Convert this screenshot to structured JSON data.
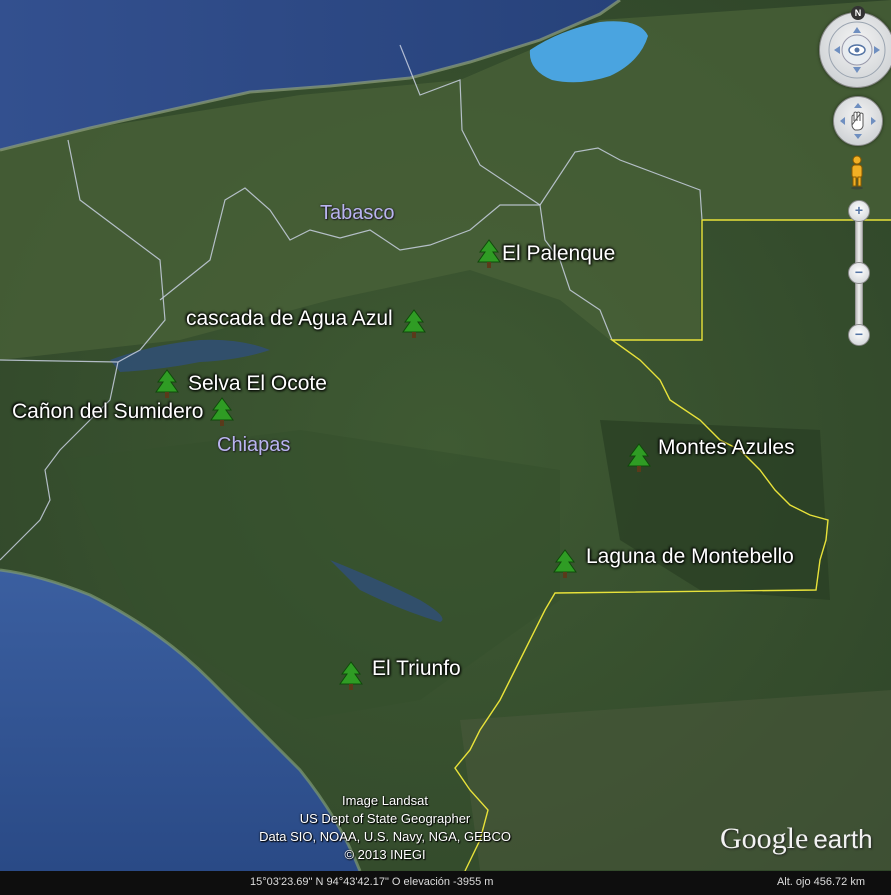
{
  "map": {
    "regions": [
      {
        "id": "tabasco",
        "label": "Tabasco"
      },
      {
        "id": "chiapas",
        "label": "Chiapas"
      }
    ],
    "placemarks": [
      {
        "id": "el-palenque",
        "label": "El Palenque",
        "icon": "green-tree-icon"
      },
      {
        "id": "cascada-agua-azul",
        "label": "cascada de Agua Azul",
        "icon": "green-tree-icon"
      },
      {
        "id": "selva-el-ocote",
        "label": "Selva El Ocote",
        "icon": "green-tree-icon"
      },
      {
        "id": "canon-del-sumidero",
        "label": "Cañon del Sumidero",
        "icon": "green-tree-icon"
      },
      {
        "id": "montes-azules",
        "label": "Montes Azules",
        "icon": "green-tree-icon"
      },
      {
        "id": "laguna-de-montebello",
        "label": "Laguna de Montebello",
        "icon": "green-tree-icon"
      },
      {
        "id": "el-triunfo",
        "label": "El Triunfo",
        "icon": "green-tree-icon"
      }
    ],
    "colors": {
      "placemark_tree": "#2f9c24",
      "region_label": "#b9b4f0",
      "international_border": "#e8e23a",
      "state_border": "#c8d0e0",
      "ocean": "#2f4f91",
      "lagoon": "#4aa4e0",
      "land": "#3c5631"
    }
  },
  "navigation": {
    "compass": {
      "north_label": "N",
      "icon": "look-compass-icon"
    },
    "move_control": {
      "icon": "hand-move-icon"
    },
    "street_view": {
      "icon": "pegman-icon"
    },
    "zoom": {
      "plus_label": "+",
      "minus_label": "−",
      "knob_label": "−"
    }
  },
  "attribution": {
    "lines": [
      "Image Landsat",
      "US Dept of State Geographer",
      "Data SIO, NOAA, U.S. Navy, NGA, GEBCO",
      "© 2013 INEGI"
    ]
  },
  "logo": {
    "google": "Google",
    "earth": "earth"
  },
  "status_bar": {
    "coordinates": "15°03'23.69\" N  94°43'42.17\" O  elevación -3955 m",
    "eye_altitude": "Alt. ojo   456.72 km"
  }
}
